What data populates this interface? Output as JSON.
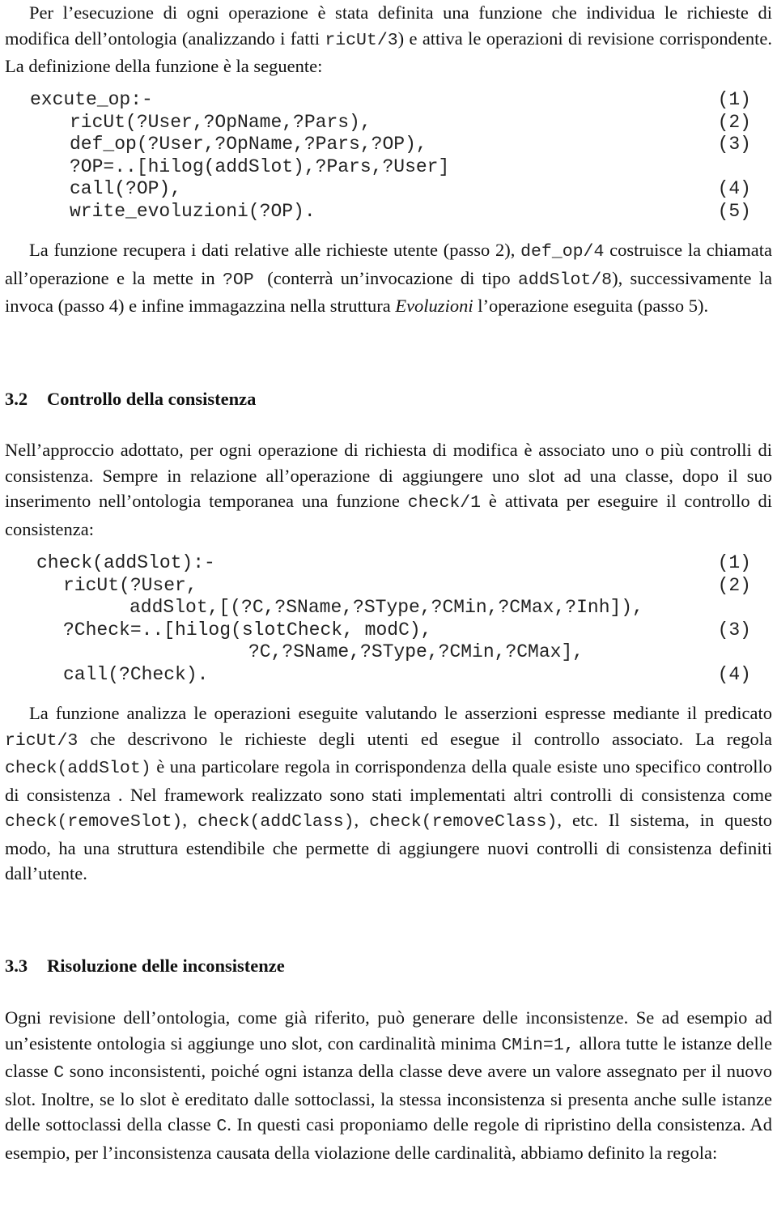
{
  "para1": {
    "a": "Per l’esecuzione di ogni operazione è stata definita una funzione che individua le richieste di modifica dell’ontologia (analizzando i fatti ",
    "code1": "ricUt/3",
    "b": ") e attiva le operazioni di revisione corrispondente. La definizione della funzione è la seguente:"
  },
  "code1": [
    {
      "text": "excute_op:-",
      "num": "(1)"
    },
    {
      "text": "ricUt(?User,?OpName,?Pars),",
      "num": "(2)"
    },
    {
      "text": "def_op(?User,?OpName,?Pars,?OP),",
      "num": "(3)"
    },
    {
      "text": "?OP=..[hilog(addSlot),?Pars,?User]",
      "num": ""
    },
    {
      "text": "call(?OP),",
      "num": "(4)"
    },
    {
      "text": "write_evoluzioni(?OP).",
      "num": "(5)"
    }
  ],
  "para2": {
    "a": "La funzione recupera i dati relative alle richieste utente (passo 2), ",
    "code1": "def_op/4",
    "b": " costruisce la chiamata all’operazione e la mette in ",
    "code2": "?OP ",
    "c": " (conterrà un’invocazione di tipo ",
    "code3": "addSlot/8",
    "d": "), successivamente la invoca (passo 4) e infine immagazzina nella struttura ",
    "em": "Evoluzioni",
    "e": " l’operazione eseguita (passo 5)."
  },
  "section32": {
    "number": "3.2",
    "title": "Controllo della consistenza"
  },
  "para3": {
    "a": "Nell’approccio adottato, per ogni operazione di richiesta di modifica è associato uno o più controlli di consistenza. Sempre in relazione all’operazione di aggiungere uno slot ad una classe, dopo il suo inserimento nell’ontologia temporanea una funzione ",
    "code1": "check/1",
    "b": "  è attivata per eseguire il controllo di consistenza:"
  },
  "code2": [
    {
      "text": "check(addSlot):-",
      "num": "(1)",
      "indent": 0
    },
    {
      "text": "ricUt(?User,",
      "num": "(2)",
      "indent": 1
    },
    {
      "text": "addSlot,[(?C,?SName,?SType,?CMin,?CMax,?Inh]),",
      "num": "",
      "indent": 2
    },
    {
      "text": "?Check=..[hilog(slotCheck, modC),",
      "num": "(3)",
      "indent": 1
    },
    {
      "text": "?C,?SName,?SType,?CMin,?CMax],",
      "num": "",
      "indent": 3
    },
    {
      "text": "call(?Check).",
      "num": "(4)",
      "indent": 1
    }
  ],
  "para4": {
    "a": "La funzione analizza le operazioni eseguite valutando le asserzioni espresse mediante il predicato ",
    "code1": "ricUt/3",
    "b": " che descrivono le richieste degli utenti ed esegue il controllo associato. La regola ",
    "code2": "check(addSlot)",
    "c": " è una particolare regola in corrispondenza della quale esiste uno specifico controllo di consistenza . Nel framework realizzato sono stati implementati altri controlli di consistenza come ",
    "code3": "check(removeSlot)",
    "d": ", ",
    "code4": "check(addClass)",
    "e": ", ",
    "code5": "check(removeClass)",
    "f": ", etc. Il sistema, in questo modo, ha una struttura estendibile che permette di aggiungere nuovi controlli di consistenza definiti dall’utente."
  },
  "section33": {
    "number": "3.3",
    "title": "Risoluzione delle inconsistenze"
  },
  "para5": {
    "a": "Ogni revisione dell’ontologia, come già riferito, può generare delle inconsistenze. Se ad esempio ad un’esistente ontologia si aggiunge uno slot, con cardinalità minima ",
    "code1": "CMin=1,",
    "b": " allora tutte le istanze delle classe ",
    "code2": "C",
    "c": " sono inconsistenti, poiché ogni istanza della classe deve avere un valore assegnato per il nuovo slot. Inoltre, se lo slot è ereditato dalle sottoclassi, la stessa inconsistenza si presenta anche sulle istanze delle sottoclassi della classe ",
    "code3": "C",
    "d": ". In questi casi proponiamo delle regole di ripristino della consistenza. Ad esempio, per l’inconsistenza causata della violazione delle cardinalità, abbiamo definito la regola:"
  }
}
